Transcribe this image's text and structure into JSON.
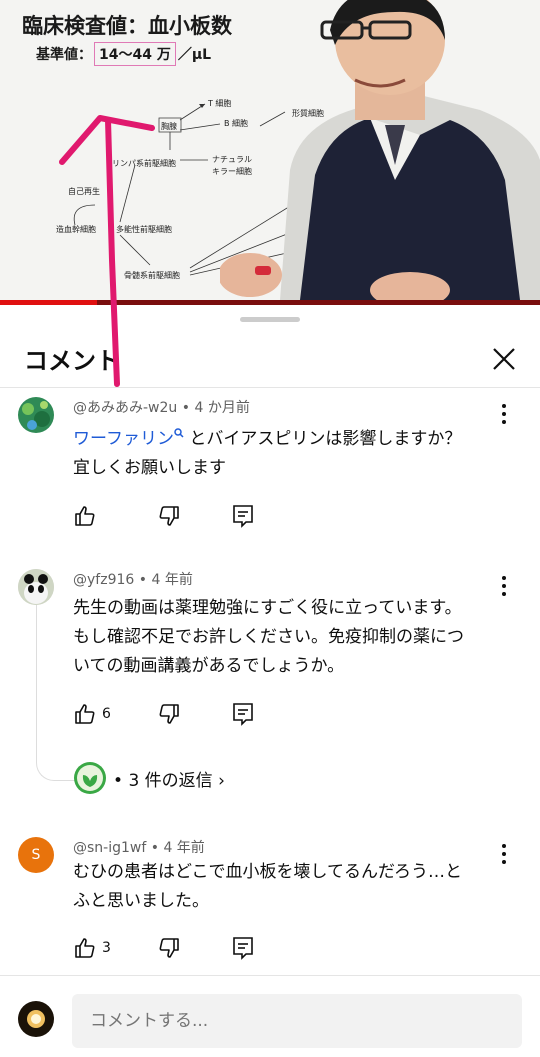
{
  "video": {
    "slide_title": "臨床検査値：血小板数",
    "slide_sub_prefix": "基準値：",
    "slide_sub_value": "14～44 万",
    "slide_sub_unit": "／μL",
    "diagram_labels": {
      "t_cell": "T 細胞",
      "b_cell": "B 細胞",
      "thymus": "胸腺",
      "plasma": "形質細胞",
      "lymphoid": "リンパ系前駆細胞",
      "nk1": "ナチュラル",
      "nk2": "キラー細胞",
      "self_renew": "自己再生",
      "hsc": "造血幹細胞",
      "mpp": "多能性前駆細胞",
      "myeloid": "骨髄系前駆細胞"
    },
    "progress_fraction": 0.18
  },
  "sheet": {
    "title": "コメント",
    "close_icon": "close-icon"
  },
  "comments": [
    {
      "author": "@あみあみ-w2u",
      "age": "4 か月前",
      "link_text": "ワーファリン",
      "text_after_link_line1": "とバイアスピリンは影響しますか？",
      "line2": "宜しくお願いします",
      "likes": ""
    },
    {
      "author": "@yfz916",
      "age": "4 年前",
      "line1": "先生の動画は薬理勉強にすごく役に立っています。",
      "line2": "もし確認不足でお許しください。免疫抑制の薬につ",
      "line3": "いての動画講義があるでしょうか。",
      "likes": "6",
      "replies": "3 件の返信"
    },
    {
      "author": "@sn-ig1wf",
      "age": "4 年前",
      "avatar_letter": "S",
      "line1": "むひの患者はどこで血小板を壊してるんだろう…と",
      "line2": "ふと思いました。",
      "likes": "3"
    }
  ],
  "composer": {
    "placeholder": "コメントする..."
  },
  "colors": {
    "link": "#1f5bd6",
    "avatar_orange": "#e8730c",
    "pink_annotation": "#e0196e"
  }
}
